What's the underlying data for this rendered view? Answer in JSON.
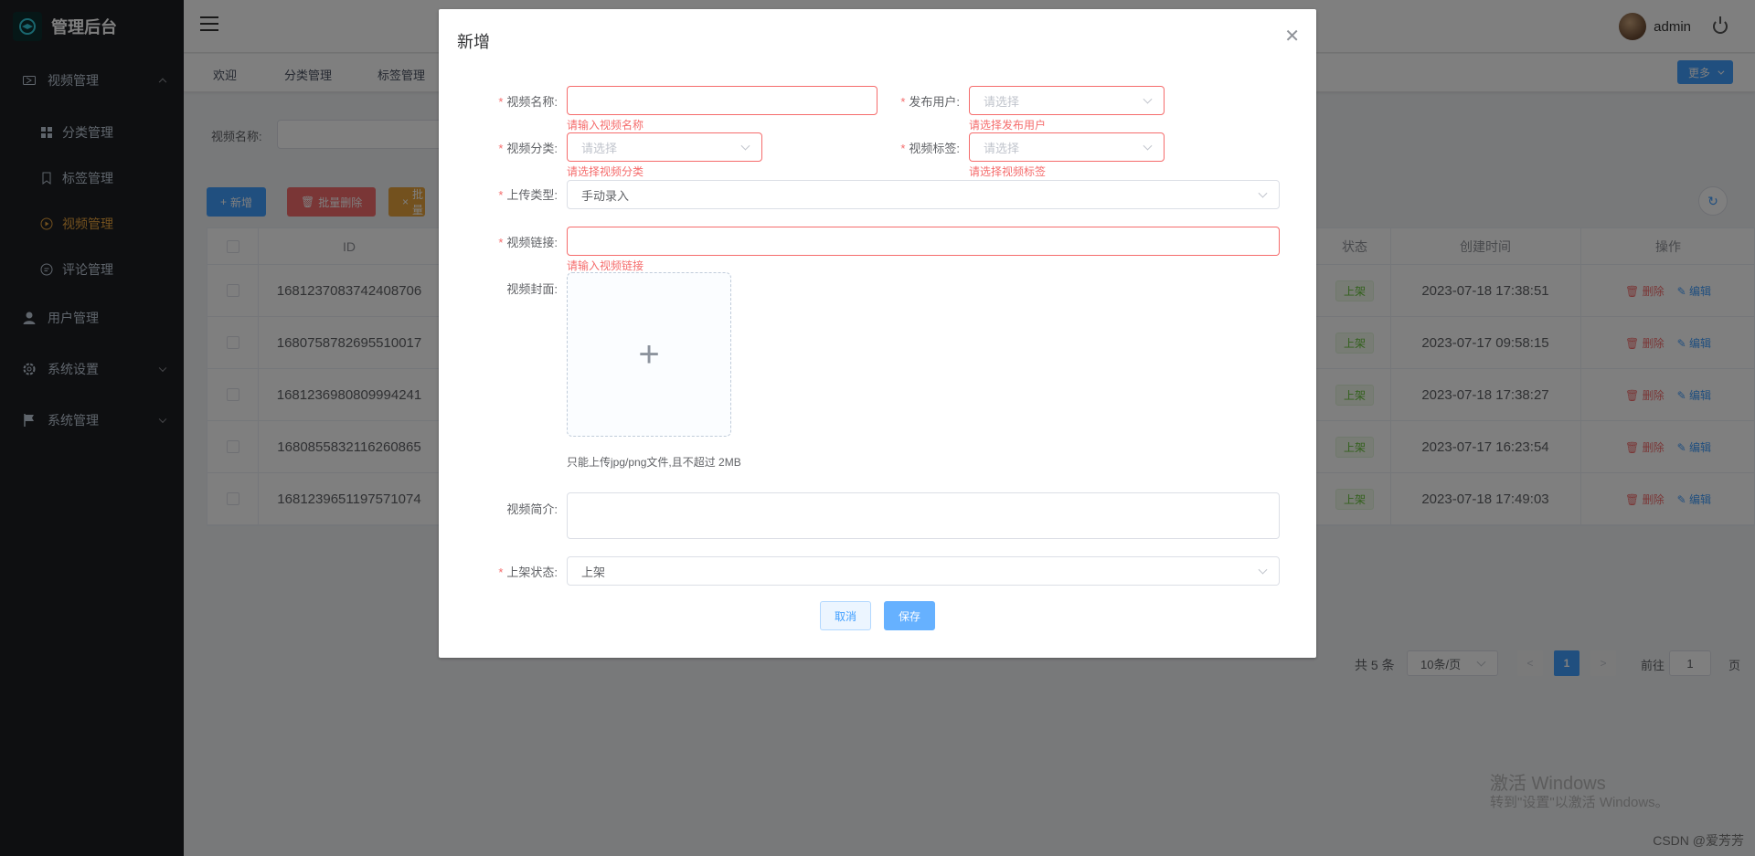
{
  "app": {
    "title": "管理后台"
  },
  "sidebar": {
    "items": [
      {
        "label": "视频管理",
        "icon": "video-icon"
      },
      {
        "label": "分类管理",
        "icon": "grid-icon"
      },
      {
        "label": "标签管理",
        "icon": "bookmark-icon"
      },
      {
        "label": "视频管理",
        "icon": "play-circle-icon",
        "active": true
      },
      {
        "label": "评论管理",
        "icon": "chat-icon"
      },
      {
        "label": "用户管理",
        "icon": "user-icon"
      },
      {
        "label": "系统设置",
        "icon": "gear-icon"
      },
      {
        "label": "系统管理",
        "icon": "flag-icon"
      }
    ]
  },
  "header": {
    "username": "admin"
  },
  "tags": {
    "items": [
      "欢迎",
      "分类管理",
      "标签管理"
    ],
    "more": "更多"
  },
  "search": {
    "label": "视频名称:"
  },
  "toolbar": {
    "add": "新增",
    "batch_delete": "批量删除",
    "batch_other": "批量"
  },
  "table": {
    "headers": {
      "id": "ID",
      "status": "状态",
      "created": "创建时间",
      "ops": "操作"
    },
    "rows": [
      {
        "id": "1681237083742408706",
        "status": "上架",
        "created": "2023-07-18 17:38:51"
      },
      {
        "id": "1680758782695510017",
        "status": "上架",
        "created": "2023-07-17 09:58:15"
      },
      {
        "id": "1681236980809994241",
        "status": "上架",
        "created": "2023-07-18 17:38:27"
      },
      {
        "id": "1680855832116260865",
        "status": "上架",
        "created": "2023-07-17 16:23:54"
      },
      {
        "id": "1681239651197571074",
        "status": "上架",
        "created": "2023-07-18 17:49:03"
      }
    ],
    "op_delete": "删除",
    "op_edit": "编辑"
  },
  "pagination": {
    "total": "共 5 条",
    "page_size": "10条/页",
    "current": "1",
    "goto": "前往",
    "jump_value": "1",
    "page_unit": "页"
  },
  "dialog": {
    "title": "新增",
    "fields": {
      "name": {
        "label": "视频名称:",
        "error": "请输入视频名称"
      },
      "user": {
        "label": "发布用户:",
        "placeholder": "请选择",
        "error": "请选择发布用户"
      },
      "category": {
        "label": "视频分类:",
        "placeholder": "请选择",
        "error": "请选择视频分类"
      },
      "tag": {
        "label": "视频标签:",
        "placeholder": "请选择",
        "error": "请选择视频标签"
      },
      "upload_type": {
        "label": "上传类型:",
        "value": "手动录入"
      },
      "link": {
        "label": "视频链接:",
        "error": "请输入视频链接"
      },
      "cover": {
        "label": "视频封面:",
        "tip": "只能上传jpg/png文件,且不超过 2MB"
      },
      "intro": {
        "label": "视频简介:"
      },
      "status": {
        "label": "上架状态:",
        "value": "上架"
      }
    },
    "cancel": "取消",
    "save": "保存"
  },
  "watermark": {
    "line1": "激活 Windows",
    "line2": "转到\"设置\"以激活 Windows。",
    "csdn": "CSDN @爱芳芳"
  },
  "colors": {
    "primary": "#409eff",
    "danger": "#f56c6c",
    "warning": "#e6a23c",
    "success": "#67c23a",
    "sidebar": "#1d1e23"
  }
}
